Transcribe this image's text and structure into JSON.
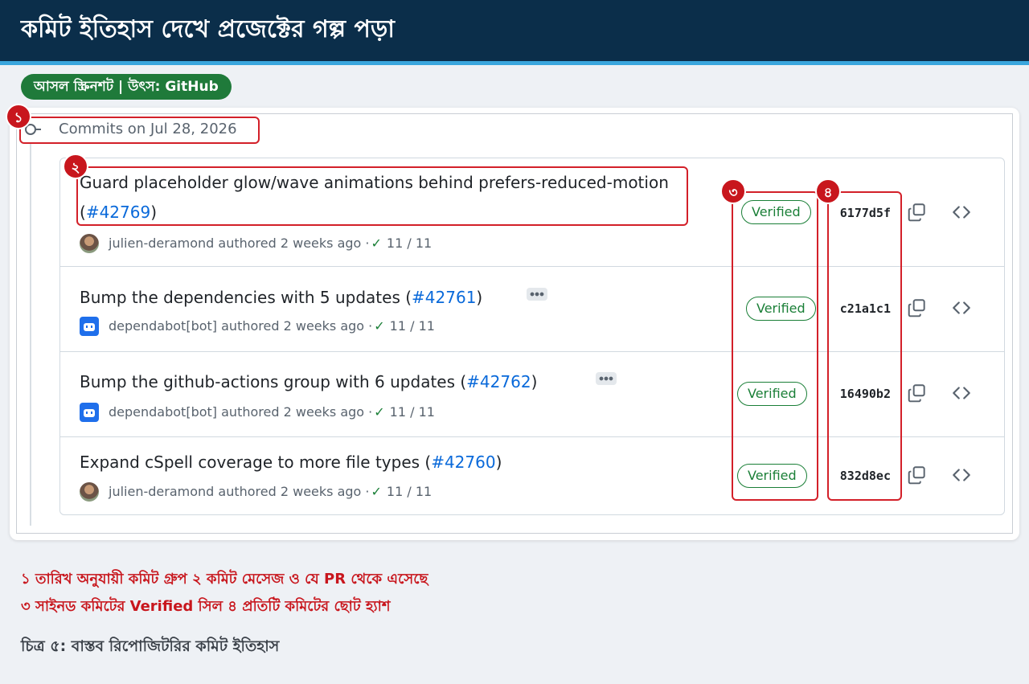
{
  "header": {
    "title": "কমিট ইতিহাস দেখে প্রজেক্টের গল্প পড়া"
  },
  "source_badge": "আসল স্ক্রিনশট | উৎস: GitHub",
  "screenshot": {
    "date_label": "Commits on Jul 28, 2026",
    "commits": [
      {
        "title": "Guard placeholder glow/wave animations behind prefers-reduced-motion (",
        "pr": "#42769",
        "title_end": ")",
        "author": "julien-deramond",
        "authored": "authored 2 weeks ago ·",
        "checks": "11 / 11",
        "verified": "Verified",
        "sha": "6177d5f",
        "avatar": "user-avatar"
      },
      {
        "title": "Bump the dependencies with 5 updates (",
        "pr": "#42761",
        "title_end": ")",
        "author": "dependabot[bot]",
        "authored": "authored 2 weeks ago ·",
        "checks": "11 / 11",
        "verified": "Verified",
        "sha": "c21a1c1",
        "avatar": "bot-avatar"
      },
      {
        "title": "Bump the github-actions group with 6 updates (",
        "pr": "#42762",
        "title_end": ")",
        "author": "dependabot[bot]",
        "authored": "authored 2 weeks ago ·",
        "checks": "11 / 11",
        "verified": "Verified",
        "sha": "16490b2",
        "avatar": "bot-avatar"
      },
      {
        "title": "Expand cSpell coverage to more file types (",
        "pr": "#42760",
        "title_end": ")",
        "author": "julien-deramond",
        "authored": "authored 2 weeks ago ·",
        "checks": "11 / 11",
        "verified": "Verified",
        "sha": "832d8ec",
        "avatar": "user-avatar"
      }
    ]
  },
  "annotations": [
    "১",
    "২",
    "৩",
    "৪"
  ],
  "legend": {
    "line1": "১ তারিখ অনুযায়ী কমিট গ্রুপ    ২ কমিট মেসেজ ও যে PR থেকে এসেছে",
    "line2": "৩ সাইনড কমিটের Verified সিল    ৪ প্রতিটি কমিটের ছোট হ্যাশ"
  },
  "caption": "চিত্র ৫: বাস্তব রিপোজিটরির কমিট ইতিহাস",
  "colors": {
    "header_bg": "#0b2e4a",
    "accent": "#3aa6dd",
    "badge": "#1f7a3a",
    "annotation": "#d32029",
    "verified": "#1a7f37",
    "link": "#0969da"
  }
}
